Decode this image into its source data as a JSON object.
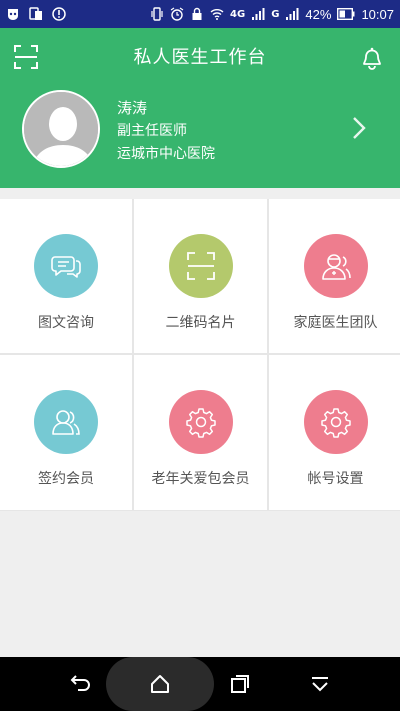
{
  "status_bar": {
    "battery": "42%",
    "time": "10:07",
    "network_4g": "4G",
    "network_g": "G"
  },
  "header": {
    "title": "私人医生工作台"
  },
  "profile": {
    "name": "涛涛",
    "position": "副主任医师",
    "hospital": "运城市中心医院"
  },
  "grid": [
    {
      "label": "图文咨询",
      "color": "#76c9d3",
      "icon": "chat-icon"
    },
    {
      "label": "二维码名片",
      "color": "#b4c96c",
      "icon": "qr-scan-icon"
    },
    {
      "label": "家庭医生团队",
      "color": "#ee7d8e",
      "icon": "doctor-team-icon"
    },
    {
      "label": "签约会员",
      "color": "#76c9d3",
      "icon": "members-icon"
    },
    {
      "label": "老年关爱包会员",
      "color": "#ee7d8e",
      "icon": "gear-icon"
    },
    {
      "label": "帐号设置",
      "color": "#ee7d8e",
      "icon": "gear-icon"
    }
  ],
  "colors": {
    "status_bar": "#1d2b86",
    "header": "#37b56d"
  }
}
